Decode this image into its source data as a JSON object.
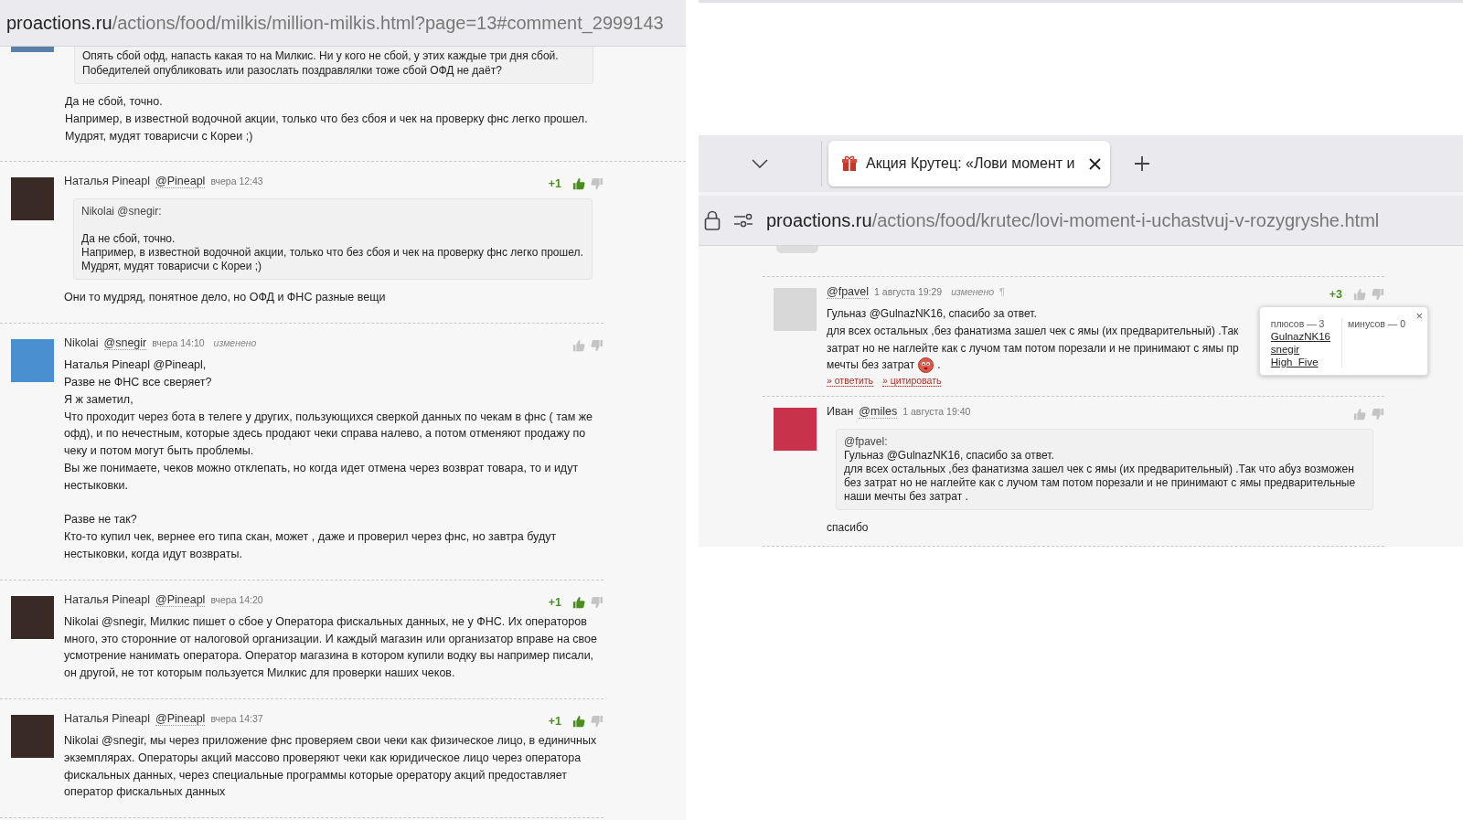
{
  "left_page": {
    "url": {
      "host": "proactions.ru",
      "path": "/actions/food/milkis/million-milkis.html?page=13#comment_2999143"
    },
    "fragment": {
      "quote_lines": [
        "Опять сбой офд, напасть какая то на Милкис. Ни у кого не сбой, у этих каждые три дня сбой.",
        "Победителей опубликовать или разослать поздравлялки тоже сбой ОФД не даёт?"
      ],
      "paragraphs": [
        [
          "Да не сбой, точно.",
          "Например, в известной водочной акции, только что без сбоя и чек на проверку фнс легко прошел.",
          "Мудрят, мудят товарисчи с Кореи ;)"
        ]
      ]
    },
    "comments": [
      {
        "avatar": {
          "kind": "photo"
        },
        "author": "Наталья Pineapl",
        "handle": "@Pineapl",
        "time": "вчера 12:43",
        "score": "+1",
        "upvoted": true,
        "quote": {
          "author": "Nikolai @snegir:",
          "lines": [
            "Да не сбой, точно.",
            "Например, в известной водочной акции, только что без сбоя и чек на проверку фнс легко прошел.",
            "Мудрят, мудят товарисчи с Кореи ;)"
          ]
        },
        "paragraphs": [
          [
            "Они то мудряд, понятное дело, но ОФД и ФНС разные вещи"
          ]
        ]
      },
      {
        "avatar": {
          "kind": "bird"
        },
        "author": "Nikolai",
        "handle": "@snegir",
        "time": "вчера 14:10",
        "edited_label": "изменено",
        "upvoted": false,
        "paragraphs": [
          [
            "Наталья Pineapl @Pineapl,",
            "Разве не ФНС все сверяет?",
            "Я ж заметил,",
            "Что проходит через бота в телеге у других, пользующихся сверкой данных по чекам в фнс ( там же офд), и по нечестным, которые здесь продают чеки справа налево, а потом отменяют продажу по чеку и потом могут быть проблемы.",
            "Вы же понимаете, чеков можно отклепать, но когда идет отмена через возврат товара, то и идут нестыковки."
          ],
          [
            "Разве не так?",
            "Кто-то купил чек, вернее его типа скан, может , даже и проверил через фнс, но завтра будут нестыковки, когда идут возвраты."
          ]
        ]
      },
      {
        "avatar": {
          "kind": "photo"
        },
        "author": "Наталья Pineapl",
        "handle": "@Pineapl",
        "time": "вчера 14:20",
        "score": "+1",
        "upvoted": true,
        "paragraphs": [
          [
            "Nikolai @snegir, Милкис пишет о сбое у Оператора фискальных данных, не у ФНС. Их операторов много, это сторонние от налоговой организации. И каждый магазин или организатор вправе на свое усмотрение нанимать оператора. Оператор магазина в котором купили водку вы например писали, он другой, не тот которым пользуется Милкис для проверки наших чеков."
          ]
        ]
      },
      {
        "avatar": {
          "kind": "photo"
        },
        "author": "Наталья Pineapl",
        "handle": "@Pineapl",
        "time": "вчера 14:37",
        "score": "+1",
        "upvoted": true,
        "paragraphs": [
          [
            "Nikolai @snegir, мы через приложение фнс проверяем свои чеки как физическое лицо, в единичных экземплярах. Операторы акций массово проверяют чеки как юридическое лицо через оператора фискальных данных, через специальные программы которые орератору акций предоставляет оператор фискальных данных"
          ]
        ]
      }
    ]
  },
  "right_page": {
    "tab": {
      "title": "Акция Крутец: «Лови момент и"
    },
    "url": {
      "host": "proactions.ru",
      "path": "/actions/food/krutec/lovi-moment-i-uchastvuj-v-rozygryshe.html"
    },
    "comments": [
      {
        "avatar": {
          "kind": "office"
        },
        "handle": "@fpavel",
        "time": "1 августа 19:29",
        "edited_label": "изменено",
        "pilcrow": "¶",
        "score": "+3",
        "upvoted": false,
        "paragraphs": [
          [
            "Гульназ @GulnazNK16, спасибо за ответ.",
            "для всех остальных ,без фанатизма зашел чек с ямы (их предварительный) .Так",
            "затрат но не наглейте как с лучом там потом порезали и не принимают с ямы пр",
            [
              {
                "text": "мечты без затрат"
              },
              {
                "kind": "smiley"
              },
              {
                "text": "."
              }
            ]
          ]
        ],
        "actions": [
          "» ответить",
          "» цитировать"
        ],
        "popup": {
          "plus_label": "плюсов — 3",
          "minus_label": "минусов — 0",
          "voters": [
            "GulnazNK16",
            "snegir",
            "High_Five"
          ],
          "close": "×"
        }
      },
      {
        "avatar": {
          "kind": "raspberry"
        },
        "author": "Иван",
        "handle": "@miles",
        "time": "1 августа 19:40",
        "upvoted": false,
        "quote": {
          "author": "@fpavel:",
          "lines": [
            "Гульназ @GulnazNK16, спасибо за ответ.",
            "для всех остальных ,без фанатизма зашел чек с ямы (их предварительный) .Так что абуз возможен без затрат но не наглейте как с лучом там потом порезали и не принимают с ямы предварительные наши мечты без затрат ."
          ]
        },
        "paragraphs": [
          [
            "спасибо"
          ]
        ]
      }
    ]
  }
}
